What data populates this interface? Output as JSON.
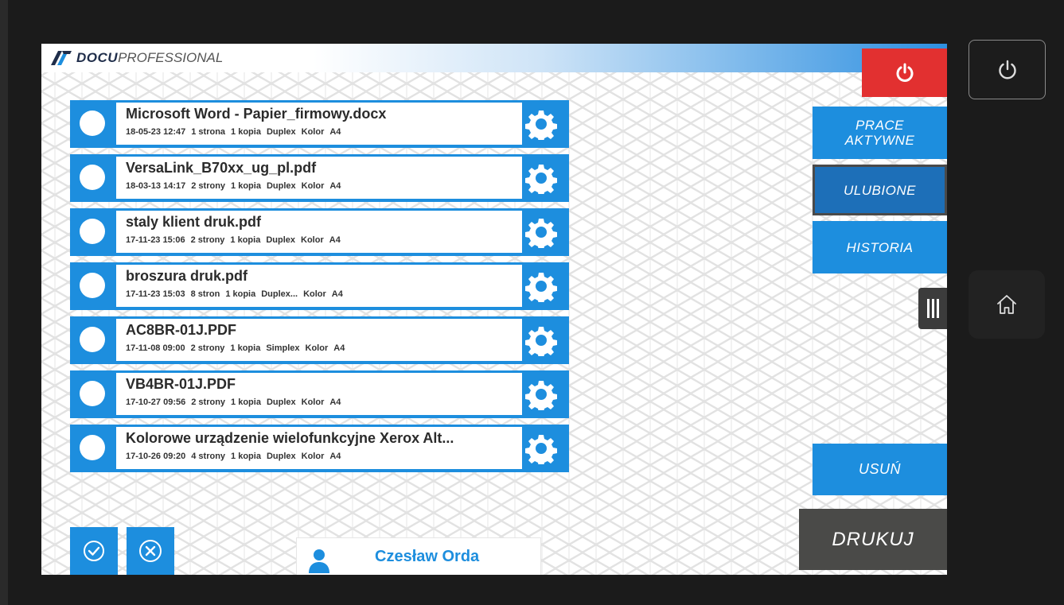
{
  "app": {
    "logo_bold": "DOCU",
    "logo_light": "PROFESSIONAL"
  },
  "jobs": [
    {
      "name": "Microsoft Word - Papier_firmowy.docx",
      "date": "18-05-23 12:47",
      "pages": "1 strona",
      "copies": "1 kopia",
      "duplex": "Duplex",
      "color": "Kolor",
      "size": "A4"
    },
    {
      "name": "VersaLink_B70xx_ug_pl.pdf",
      "date": "18-03-13 14:17",
      "pages": "2 strony",
      "copies": "1 kopia",
      "duplex": "Duplex",
      "color": "Kolor",
      "size": "A4"
    },
    {
      "name": "staly klient druk.pdf",
      "date": "17-11-23 15:06",
      "pages": "2 strony",
      "copies": "1 kopia",
      "duplex": "Duplex",
      "color": "Kolor",
      "size": "A4"
    },
    {
      "name": "broszura druk.pdf",
      "date": "17-11-23 15:03",
      "pages": "8 stron",
      "copies": "1 kopia",
      "duplex": "Duplex...",
      "color": "Kolor",
      "size": "A4"
    },
    {
      "name": "AC8BR-01J.PDF",
      "date": "17-11-08 09:00",
      "pages": "2 strony",
      "copies": "1 kopia",
      "duplex": "Simplex",
      "color": "Kolor",
      "size": "A4"
    },
    {
      "name": "VB4BR-01J.PDF",
      "date": "17-10-27 09:56",
      "pages": "2 strony",
      "copies": "1 kopia",
      "duplex": "Duplex",
      "color": "Kolor",
      "size": "A4"
    },
    {
      "name": "Kolorowe urządzenie wielofunkcyjne Xerox Alt...",
      "date": "17-10-26 09:20",
      "pages": "4 strony",
      "copies": "1 kopia",
      "duplex": "Duplex",
      "color": "Kolor",
      "size": "A4"
    }
  ],
  "side_menu": {
    "active_jobs": "PRACE AKTYWNE",
    "favorites": "ULUBIONE",
    "history": "HISTORIA",
    "delete": "USUŃ",
    "print": "DRUKUJ"
  },
  "user": {
    "name": "Czesław Orda"
  },
  "icons": {
    "power": "power-icon",
    "gear": "gear-icon",
    "check": "check-circle-icon",
    "cancel": "x-circle-icon",
    "user": "user-icon",
    "home": "home-icon",
    "handle": "grip-icon"
  },
  "colors": {
    "accent": "#1d8ede",
    "power": "#e23030",
    "print_button": "#4a4a48"
  }
}
